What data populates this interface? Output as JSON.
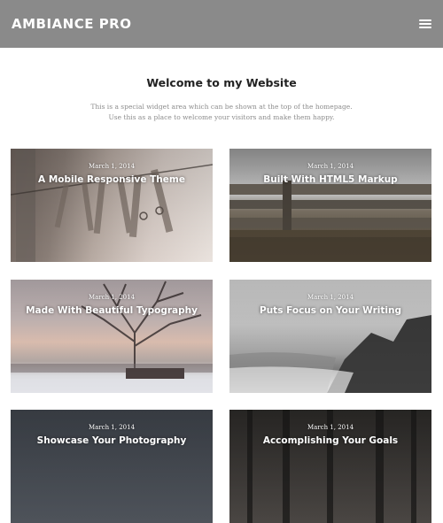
{
  "header": {
    "brand": "AMBIANCE PRO",
    "menu_icon": "hamburger-menu-icon",
    "bg_color": "#8a8a8a"
  },
  "welcome": {
    "title": "Welcome to my Website",
    "line1": "This is a special widget area which can be shown at the top of the homepage.",
    "line2": "Use this as a place to welcome your visitors and make them happy."
  },
  "posts": [
    {
      "date": "March 1, 2014",
      "title": "A Mobile Responsive Theme"
    },
    {
      "date": "March 1, 2014",
      "title": "Built With HTML5 Markup"
    },
    {
      "date": "March 1, 2014",
      "title": "Made With Beautiful Typography"
    },
    {
      "date": "March 1, 2014",
      "title": "Puts Focus on Your Writing"
    },
    {
      "date": "March 1, 2014",
      "title": "Showcase Your Photography"
    },
    {
      "date": "March 1, 2014",
      "title": "Accomplishing Your Goals"
    }
  ]
}
